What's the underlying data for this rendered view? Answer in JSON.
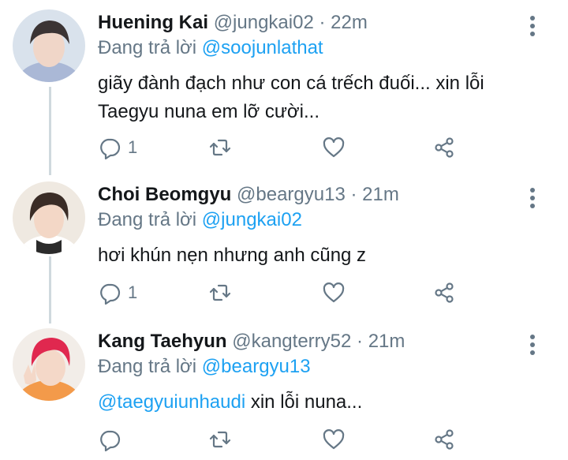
{
  "tweets": [
    {
      "name": "Huening Kai",
      "handle": "@jungkai02",
      "separator": "·",
      "time": "22m",
      "reply_prefix": "Đang trả lời",
      "reply_to": "@soojunlathat",
      "text_line1": "giãy đành đạch như con cá trếch đuối... xin lỗi",
      "text_line2": "Taegyu nuna em lỡ cười...",
      "reply_count": "1",
      "avatar_colors": {
        "bg": "#d9e2ec",
        "hair": "#3b3434",
        "skin": "#f0d6c8",
        "clothes": "#aab8d6"
      }
    },
    {
      "name": "Choi Beomgyu",
      "handle": "@beargyu13",
      "separator": "·",
      "time": "21m",
      "reply_prefix": "Đang trả lời",
      "reply_to": "@jungkai02",
      "text_line1": "hơi khún nẹn nhưng anh cũng z",
      "reply_count": "1",
      "avatar_colors": {
        "bg": "#efe9e1",
        "hair": "#3a2c26",
        "skin": "#f3d7c6",
        "clothes": "#ffffff"
      }
    },
    {
      "name": "Kang Taehyun",
      "handle": "@kangterry52",
      "separator": "·",
      "time": "21m",
      "reply_prefix": "Đang trả lời",
      "reply_to": "@beargyu13",
      "text_mention": "@taegyuiunhaudi",
      "text_rest": " xin lỗi nuna...",
      "reply_count": "",
      "avatar_colors": {
        "bg": "#f2ede8",
        "hair": "#e0284f",
        "skin": "#f4d8c8",
        "clothes": "#f39a4a"
      }
    }
  ],
  "colors": {
    "accent": "#1da1f2",
    "muted": "#657786",
    "text": "#14171a"
  },
  "icons": [
    "reply-icon",
    "retweet-icon",
    "like-icon",
    "share-icon",
    "more-icon"
  ]
}
